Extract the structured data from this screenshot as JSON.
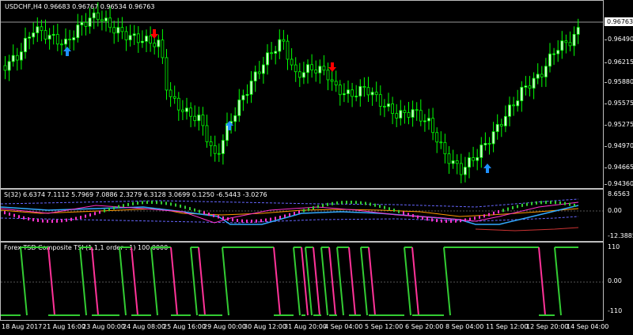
{
  "main_chart": {
    "title": "USDCHF,H4  0.96683 0.96767 0.96534 0.96763",
    "current_price": "0.96763",
    "y_labels": [
      "0.96763",
      "0.96490",
      "0.96215",
      "0.95880",
      "0.95575",
      "0.95275",
      "0.94970",
      "0.94665",
      "0.94360"
    ]
  },
  "indicator1": {
    "title": "S(32) 6.6374 7.1112 5.7969 7.0886 2.3279 6.3128 3.0699 0.1250 -6.5443 -3.0276",
    "y_labels": [
      "8.6563",
      "0.00",
      "-12.3885"
    ]
  },
  "indicator2": {
    "title": "Forex TSD Composite TSI (1,1,1 order : 1) 100.0000",
    "y_labels": [
      "110",
      "0.00",
      "-110"
    ]
  },
  "time_axis": {
    "labels": [
      "18 Aug 2017",
      "21 Aug 16:00",
      "23 Aug 00:00",
      "24 Aug 08:00",
      "25 Aug 16:00",
      "29 Aug 00:00",
      "30 Aug 12:00",
      "31 Aug 20:00",
      "4 Sep 04:00",
      "5 Sep 12:00",
      "6 Sep 20:00",
      "8 Sep 04:00",
      "11 Sep 12:00",
      "12 Sep 20:00",
      "14 Sep 04:00"
    ]
  },
  "colors": {
    "bull_candle": "#ccffcc",
    "wick": "#00ff00",
    "up_arrow": "#1e90ff",
    "down_arrow": "#ff0000",
    "tsi_up": "#33cc33",
    "tsi_down": "#ff3399"
  },
  "signals": {
    "up_arrow_icon": "arrow-up-icon",
    "down_arrow_icon": "arrow-down-icon"
  }
}
